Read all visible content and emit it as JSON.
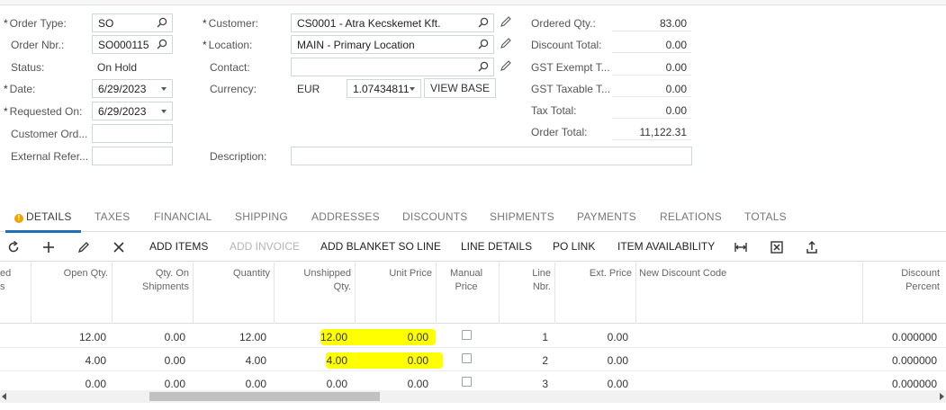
{
  "header": {
    "order_type": {
      "label": "Order Type:",
      "value": "SO"
    },
    "order_nbr": {
      "label": "Order Nbr.:",
      "value": "SO000115"
    },
    "status": {
      "label": "Status:",
      "value": "On Hold"
    },
    "date": {
      "label": "Date:",
      "value": "6/29/2023"
    },
    "requested_on": {
      "label": "Requested On:",
      "value": "6/29/2023"
    },
    "customer_ord": {
      "label": "Customer Ord...",
      "value": ""
    },
    "external_ref": {
      "label": "External Refer...",
      "value": ""
    },
    "customer": {
      "label": "Customer:",
      "value": "CS0001 - Atra Kecskemet Kft."
    },
    "location": {
      "label": "Location:",
      "value": "MAIN - Primary Location"
    },
    "contact": {
      "label": "Contact:",
      "value": ""
    },
    "currency": {
      "label": "Currency:",
      "code": "EUR",
      "rate": "1.07434811",
      "view_base": "VIEW BASE"
    },
    "description": {
      "label": "Description:",
      "value": ""
    }
  },
  "totals": {
    "ordered_qty": {
      "label": "Ordered Qty.:",
      "value": "83.00"
    },
    "discount_total": {
      "label": "Discount Total:",
      "value": "0.00"
    },
    "gst_exempt": {
      "label": "GST Exempt T...",
      "value": "0.00"
    },
    "gst_taxable": {
      "label": "GST Taxable T...",
      "value": "0.00"
    },
    "tax_total": {
      "label": "Tax Total:",
      "value": "0.00"
    },
    "order_total": {
      "label": "Order Total:",
      "value": "11,122.31"
    }
  },
  "tabs": [
    {
      "label": "DETAILS",
      "active": true
    },
    {
      "label": "TAXES"
    },
    {
      "label": "FINANCIAL"
    },
    {
      "label": "SHIPPING"
    },
    {
      "label": "ADDRESSES"
    },
    {
      "label": "DISCOUNTS"
    },
    {
      "label": "SHIPMENTS"
    },
    {
      "label": "PAYMENTS"
    },
    {
      "label": "RELATIONS"
    },
    {
      "label": "TOTALS"
    }
  ],
  "toolbar": {
    "add_items": "ADD ITEMS",
    "add_invoice": "ADD INVOICE",
    "add_blanket": "ADD BLANKET SO LINE",
    "line_details": "LINE DETAILS",
    "po_link": "PO LINK",
    "item_availability": "ITEM AVAILABILITY"
  },
  "grid": {
    "columns": {
      "partial_1": "ed",
      "partial_2": "s",
      "open_qty": "Open Qty.",
      "qty_on_ship_1": "Qty. On",
      "qty_on_ship_2": "Shipments",
      "quantity": "Quantity",
      "unshipped_1": "Unshipped",
      "unshipped_2": "Qty.",
      "unit_price": "Unit Price",
      "manual_1": "Manual",
      "manual_2": "Price",
      "line_nbr_1": "Line",
      "line_nbr_2": "Nbr.",
      "ext_price": "Ext. Price",
      "new_discount_code": "New Discount Code",
      "discount_pct_1": "Discount",
      "discount_pct_2": "Percent"
    },
    "rows": [
      {
        "open_qty": "12.00",
        "qty_on_shipments": "0.00",
        "quantity": "12.00",
        "unshipped_qty": "12.00",
        "unit_price": "0.00",
        "line_nbr": "1",
        "ext_price": "0.00",
        "discount_percent": "0.000000"
      },
      {
        "open_qty": "4.00",
        "qty_on_shipments": "0.00",
        "quantity": "4.00",
        "unshipped_qty": "4.00",
        "unit_price": "0.00",
        "line_nbr": "2",
        "ext_price": "0.00",
        "discount_percent": "0.000000"
      },
      {
        "open_qty": "0.00",
        "qty_on_shipments": "0.00",
        "quantity": "0.00",
        "unshipped_qty": "0.00",
        "unit_price": "0.00",
        "line_nbr": "3",
        "ext_price": "0.00",
        "discount_percent": "0.000000"
      }
    ]
  },
  "colors": {
    "highlight": "#ffff00",
    "accent": "#1f6fb5",
    "warning": "#f0a500"
  }
}
